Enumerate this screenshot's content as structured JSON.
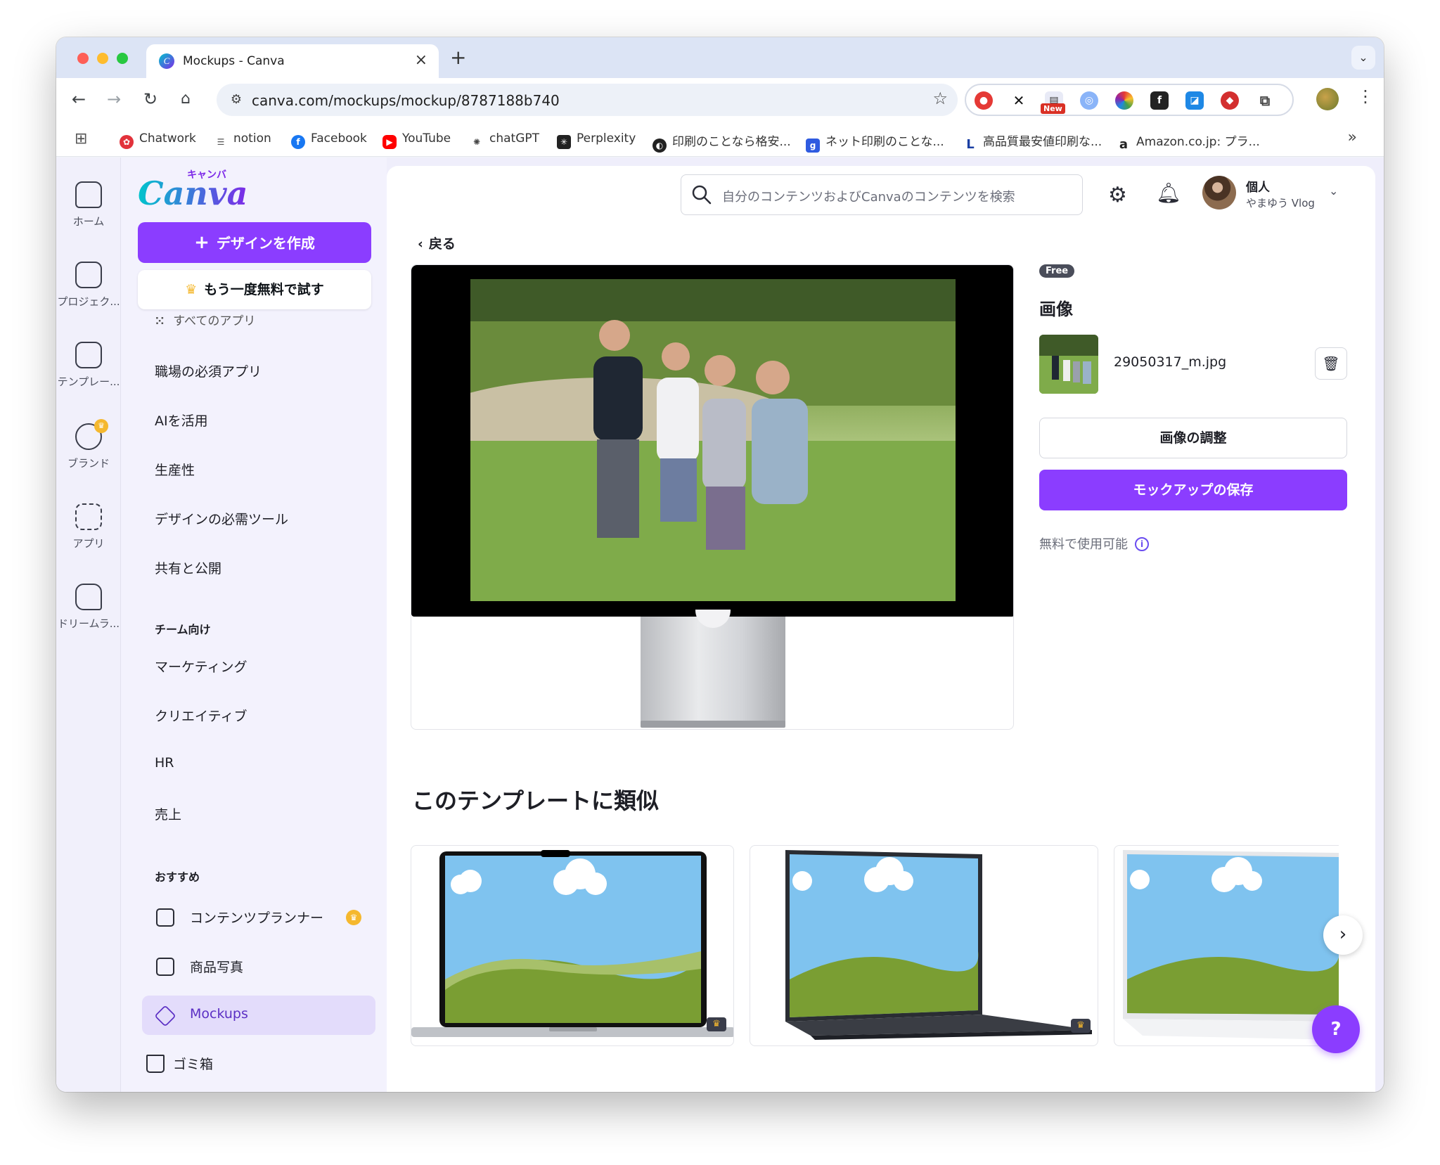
{
  "browser": {
    "tab_title": "Mockups - Canva",
    "url": "canva.com/mockups/mockup/8787188b740",
    "new_badge": "New",
    "bookmarks": [
      {
        "label": "Chatwork",
        "icon": "chatwork-icon",
        "color": "#e2323b"
      },
      {
        "label": "notion",
        "icon": "notion-icon",
        "color": "#555555"
      },
      {
        "label": "Facebook",
        "icon": "facebook-icon",
        "color": "#1877f2"
      },
      {
        "label": "YouTube",
        "icon": "youtube-icon",
        "color": "#ff0000"
      },
      {
        "label": "chatGPT",
        "icon": "chatgpt-icon",
        "color": "#444444"
      },
      {
        "label": "Perplexity",
        "icon": "perplexity-icon",
        "color": "#222222"
      },
      {
        "label": "印刷のことなら格安...",
        "icon": "print-icon",
        "color": "#222222"
      },
      {
        "label": "ネット印刷のことな...",
        "icon": "net-print-icon",
        "color": "#2f5be0"
      },
      {
        "label": "高品質最安値印刷な...",
        "icon": "l-icon",
        "color": "#1a3fa3"
      },
      {
        "label": "Amazon.co.jp: プラ...",
        "icon": "amazon-icon",
        "color": "#222222"
      }
    ]
  },
  "rail": {
    "items": [
      {
        "label": "ホーム",
        "icon": "home-icon"
      },
      {
        "label": "プロジェク...",
        "icon": "folder-icon"
      },
      {
        "label": "テンプレー...",
        "icon": "template-icon"
      },
      {
        "label": "ブランド",
        "icon": "brand-icon"
      },
      {
        "label": "アプリ",
        "icon": "apps-icon"
      },
      {
        "label": "ドリームラ...",
        "icon": "dream-lab-icon"
      }
    ]
  },
  "sidebar": {
    "logo": "Canva",
    "logo_kana": "キャンバ",
    "create_button": "デザインを作成",
    "trial_button": "もう一度無料で試す",
    "all_apps_partial": "すべてのアプリ",
    "items": [
      "職場の必須アプリ",
      "AIを活用",
      "生産性",
      "デザインの必需ツール",
      "共有と公開"
    ],
    "team_heading": "チーム向け",
    "team_items": [
      "マーケティング",
      "クリエイティブ",
      "HR",
      "売上"
    ],
    "recommended_heading": "おすすめ",
    "recommended_items": [
      {
        "label": "コンテンツプランナー",
        "icon": "calendar-icon"
      },
      {
        "label": "商品写真",
        "icon": "product-photo-icon"
      },
      {
        "label": "Mockups",
        "icon": "mockups-icon"
      }
    ],
    "trash": "ゴミ箱"
  },
  "header": {
    "search_placeholder": "自分のコンテンツおよびCanvaのコンテンツを検索",
    "account_name": "個人",
    "account_sub": "やまゆう Vlog"
  },
  "mockup": {
    "back_label": "戻る",
    "free_badge": "Free",
    "panel_title": "画像",
    "file_name": "29050317_m.jpg",
    "adjust_button": "画像の調整",
    "save_button": "モックアップの保存",
    "free_note": "無料で使用可能"
  },
  "similar": {
    "title": "このテンプレートに類似"
  },
  "help": "?",
  "colors": {
    "accent": "#8b3dff",
    "accent_light": "#e3dcfb"
  }
}
